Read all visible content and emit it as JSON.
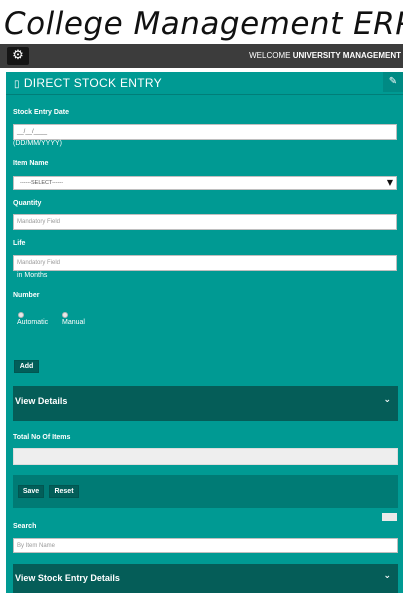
{
  "app": {
    "title": "College Management ERP",
    "welcome_prefix": "WELCOME",
    "welcome_user": "UNIVERSITY MANAGEMENT"
  },
  "panel": {
    "title": "DIRECT STOCK ENTRY"
  },
  "form": {
    "stock_entry_date": {
      "label": "Stock Entry Date",
      "value": "__/__/____",
      "format_hint": "(DD/MM/YYYY)"
    },
    "item_name": {
      "label": "Item Name",
      "selected": "------SELECT------"
    },
    "quantity": {
      "label": "Quantity",
      "placeholder": "Mandatory Field"
    },
    "life": {
      "label": "Life",
      "placeholder": "Mandatory Field",
      "unit_hint": "in Months"
    },
    "number": {
      "label": "Number",
      "options": [
        "Automatic",
        "Manual"
      ]
    },
    "add_label": "Add"
  },
  "view_details": {
    "title": "View Details"
  },
  "total": {
    "label": "Total No Of Items",
    "value": ""
  },
  "actions": {
    "save_label": "Save",
    "reset_label": "Reset"
  },
  "search": {
    "label": "Search",
    "placeholder": "By Item Name"
  },
  "view_stock": {
    "title": "View Stock Entry Details"
  },
  "icons": {
    "settings": "gear-icon",
    "panel_marker": "square-icon",
    "panel_tool": "pencil-icon",
    "expand": "chevron-down-icon",
    "dropdown": "triangle-down-icon"
  },
  "colors": {
    "panel_bg": "#009a93",
    "dark_block": "#055d58",
    "topbar": "#3c3c3c"
  }
}
